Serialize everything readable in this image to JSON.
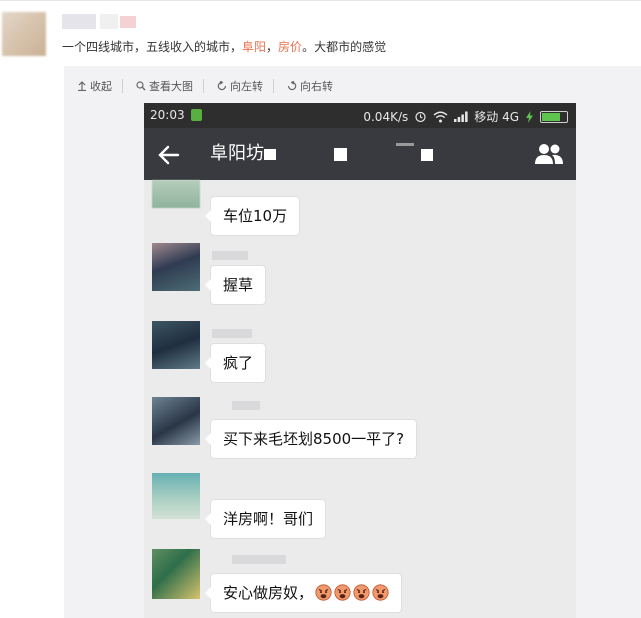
{
  "post": {
    "text_before": "一个四线城市，五线收入的城市，",
    "tag_1": "阜阳",
    "separator": "，",
    "tag_2": "房价",
    "text_after": "。大都市的感觉",
    "tag_color": "#eb7350"
  },
  "toolbar": {
    "collapse": "收起",
    "view_large": "查看大图",
    "rotate_left": "向左转",
    "rotate_right": "向右转"
  },
  "phone": {
    "status": {
      "time": "20:03",
      "speed": "0.04K/s",
      "carrier": "移动 4G"
    },
    "chat_title": "阜阳坊",
    "messages": [
      {
        "text": "车位10万"
      },
      {
        "text": "握草"
      },
      {
        "text": "疯了"
      },
      {
        "text": "买下来毛坯划8500一平了?"
      },
      {
        "text": "洋房啊！哥们"
      },
      {
        "text": "安心做房奴，"
      }
    ],
    "emoji_count": 4,
    "colors": {
      "status_bar": "#2e2e2e",
      "nav_bar": "#393a3f",
      "chat_bg": "#ebebeb",
      "bubble": "#ffffff"
    }
  }
}
